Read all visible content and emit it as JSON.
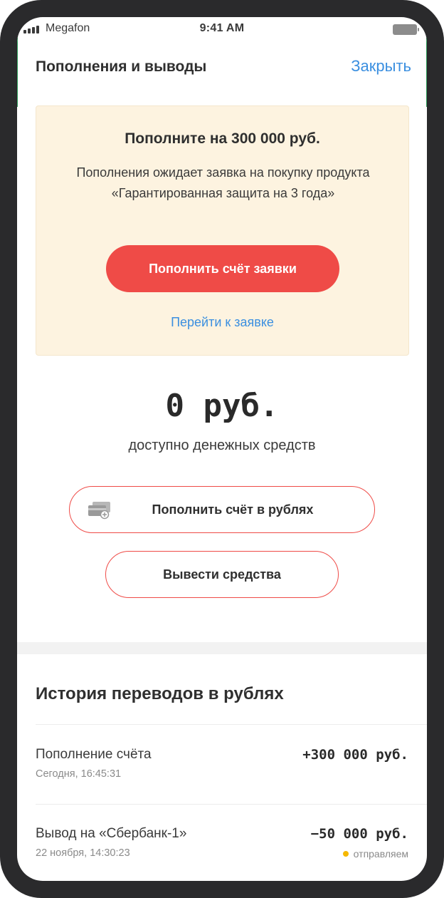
{
  "status_bar": {
    "carrier": "Megafon",
    "time": "9:41 AM"
  },
  "header": {
    "title": "Пополнения и выводы",
    "close_label": "Закрыть"
  },
  "application_card": {
    "title": "Пополните на 300 000 руб.",
    "description": "Пополнения ожидает заявка на покупку продукта «Гарантированная защита на 3 года»",
    "fund_button_label": "Пополнить счёт заявки",
    "link_label": "Перейти к заявке"
  },
  "balance": {
    "amount": "0 руб.",
    "caption": "доступно денежных средств"
  },
  "actions": {
    "topup_label": "Пополнить счёт в рублях",
    "withdraw_label": "Вывести средства"
  },
  "history": {
    "title": "История переводов в рублях",
    "transactions": [
      {
        "title": "Пополнение счёта",
        "date": "Сегодня, 16:45:31",
        "amount": "+300 000 руб.",
        "status": ""
      },
      {
        "title": "Вывод на «Сбербанк-1»",
        "date": "22 ноября, 14:30:23",
        "amount": "−50 000 руб.",
        "status": "отправляем"
      }
    ]
  },
  "colors": {
    "accent": "#ef4b47",
    "link": "#3b8fe0",
    "card_bg": "#fdf3e0",
    "status_pending": "#f5b800"
  }
}
